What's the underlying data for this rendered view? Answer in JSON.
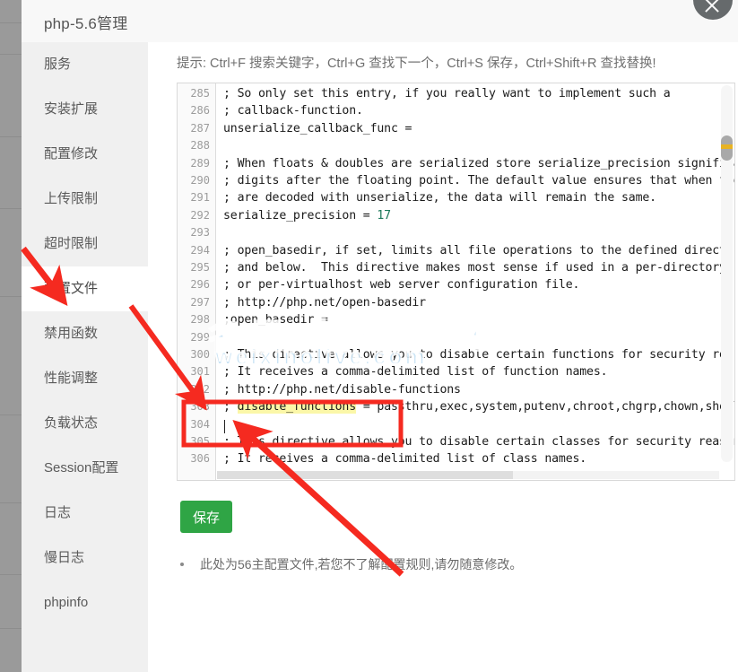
{
  "window": {
    "title": "php-5.6管理",
    "close_icon": "close-icon"
  },
  "sidebar": {
    "items": [
      {
        "label": "服务",
        "active": false
      },
      {
        "label": "安装扩展",
        "active": false
      },
      {
        "label": "配置修改",
        "active": false
      },
      {
        "label": "上传限制",
        "active": false
      },
      {
        "label": "超时限制",
        "active": false
      },
      {
        "label": "配置文件",
        "active": true
      },
      {
        "label": "禁用函数",
        "active": false
      },
      {
        "label": "性能调整",
        "active": false
      },
      {
        "label": "负载状态",
        "active": false
      },
      {
        "label": "Session配置",
        "active": false
      },
      {
        "label": "日志",
        "active": false
      },
      {
        "label": "慢日志",
        "active": false
      },
      {
        "label": "phpinfo",
        "active": false
      }
    ]
  },
  "main": {
    "hint": "提示: Ctrl+F 搜索关键字，Ctrl+G 查找下一个，Ctrl+S 保存，Ctrl+Shift+R 查找替换!",
    "save_label": "保存",
    "note": "此处为56主配置文件,若您不了解配置规则,请勿随意修改。"
  },
  "editor": {
    "first_line_number": 285,
    "lines": [
      {
        "n": "285",
        "text": "; So only set this entry, if you really want to implement such a"
      },
      {
        "n": "286",
        "text": "; callback-function."
      },
      {
        "n": "287",
        "text": "unserialize_callback_func ="
      },
      {
        "n": "288",
        "text": ""
      },
      {
        "n": "289",
        "text": "; When floats & doubles are serialized store serialize_precision significan"
      },
      {
        "n": "290",
        "text": "; digits after the floating point. The default value ensures that when floa"
      },
      {
        "n": "291",
        "text": "; are decoded with unserialize, the data will remain the same."
      },
      {
        "n": "292",
        "text": "serialize_precision = 17",
        "value": "17"
      },
      {
        "n": "293",
        "text": ""
      },
      {
        "n": "294",
        "text": "; open_basedir, if set, limits all file operations to the defined directory"
      },
      {
        "n": "295",
        "text": "; and below.  This directive makes most sense if used in a per-directory"
      },
      {
        "n": "296",
        "text": "; or per-virtualhost web server configuration file."
      },
      {
        "n": "297",
        "text": "; http://php.net/open-basedir"
      },
      {
        "n": "298",
        "text": ";open_basedir ="
      },
      {
        "n": "299",
        "text": ""
      },
      {
        "n": "300",
        "text": "; This directive allows you to disable certain functions for security reaso"
      },
      {
        "n": "301",
        "text": "; It receives a comma-delimited list of function names."
      },
      {
        "n": "302",
        "text": "; http://php.net/disable-functions"
      },
      {
        "n": "303",
        "text": "; disable_functions = passthru,exec,system,putenv,chroot,chgrp,chown,shell_",
        "highlight": "disable_functions"
      },
      {
        "n": "304",
        "text": ""
      },
      {
        "n": "305",
        "text": "; This directive allows you to disable certain classes for security reasons"
      },
      {
        "n": "306",
        "text": "; It receives a comma-delimited list of class names."
      }
    ],
    "highlight_color": "#fbf7a8",
    "scroll_marker_color": "#e8b324"
  },
  "watermark": {
    "cn": "名录 拾建 教程",
    "en": "weixinolive.com"
  },
  "annotations": {
    "arrow_color": "#f52a20",
    "box_color": "#f52a20",
    "arrow_targets": [
      "配置文件",
      "line-303-disable_functions"
    ]
  },
  "colors": {
    "accent_green": "#2fa545",
    "sidebar_bg": "#f0f0f0",
    "title_bg": "#f8f8f8",
    "highlight_yellow": "#fbf7a8",
    "annotation_red": "#f52a20",
    "watermark_blue": "#bcdcf2"
  }
}
